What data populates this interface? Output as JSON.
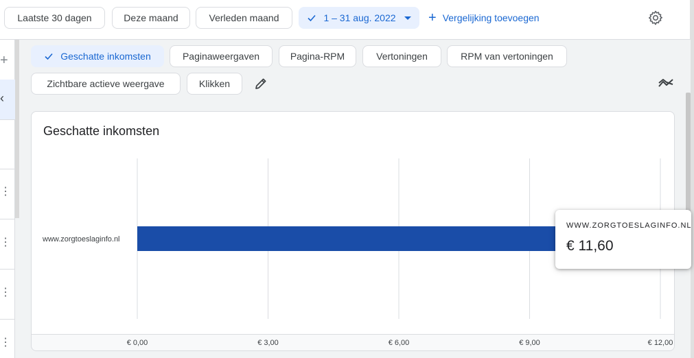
{
  "date_filters": {
    "last30": "Laatste 30 dagen",
    "this_month": "Deze maand",
    "last_month": "Verleden maand",
    "selected_range": "1 – 31 aug. 2022",
    "add_comparison": "Vergelijking toevoegen"
  },
  "metrics": {
    "estimated_earnings": "Geschatte inkomsten",
    "page_views": "Paginaweergaven",
    "page_rpm": "Pagina-RPM",
    "impressions": "Vertoningen",
    "impression_rpm": "RPM van vertoningen",
    "active_view_viewable": "Zichtbare actieve weergave",
    "clicks": "Klikken"
  },
  "colors": {
    "accent": "#1967d2",
    "bar": "#1a4da8",
    "selected_bg": "#e8f0fe"
  },
  "card": {
    "title": "Geschatte inkomsten"
  },
  "chart_data": {
    "type": "bar",
    "orientation": "horizontal",
    "title": "Geschatte inkomsten",
    "categories": [
      "www.zorgtoeslaginfo.nl"
    ],
    "values": [
      11.6
    ],
    "xlim": [
      0,
      12
    ],
    "ticks": [
      0,
      3,
      6,
      9,
      12
    ],
    "tick_labels": [
      "€ 0,00",
      "€ 3,00",
      "€ 6,00",
      "€ 9,00",
      "€ 12,00"
    ],
    "grid": true
  },
  "tooltip": {
    "label": "WWW.ZORGTOESLAGINFO.NL",
    "value": "€ 11,60"
  }
}
